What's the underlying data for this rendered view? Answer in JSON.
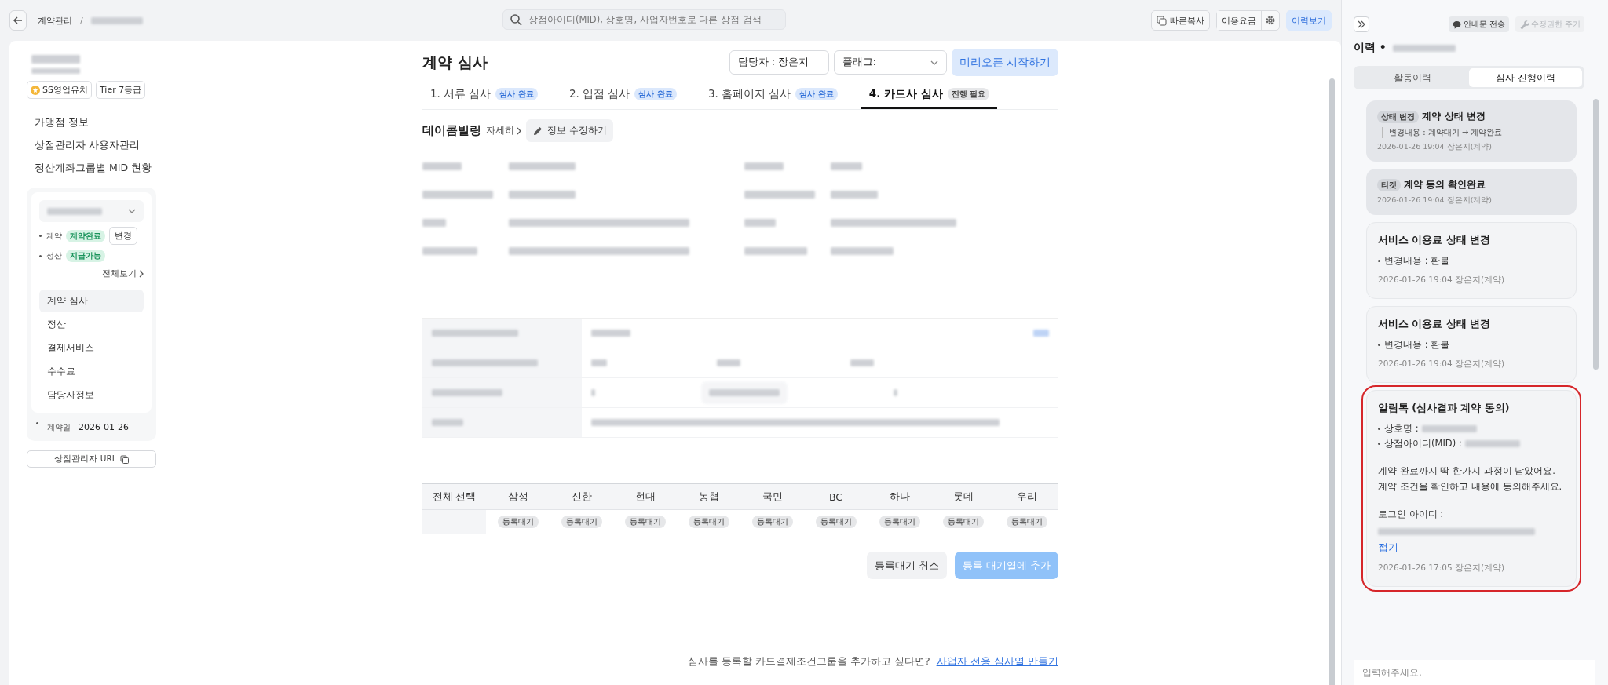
{
  "topbar": {
    "breadcrumb": "계약관리",
    "separator": "/",
    "search_placeholder": "상점아이디(MID), 상호명, 사업자번호로 다른 상점 검색",
    "buttons": [
      {
        "label": "빠른복사",
        "kind": "copy",
        "selected": false
      },
      {
        "label": "이용요금",
        "kind": "fee",
        "selected": false
      },
      {
        "label": "이력보기",
        "kind": "history",
        "selected": true
      }
    ]
  },
  "sidebar": {
    "badges": [
      {
        "label": "SS영업유치",
        "kind": "star"
      },
      {
        "label": "Tier 7등급",
        "kind": "plain"
      }
    ],
    "links": [
      "가맹점 정보",
      "상점관리자 사용자관리",
      "정산계좌그룹별 MID 현황"
    ],
    "contract_card": {
      "status_rows": [
        {
          "label": "계약",
          "badge": "계약완료",
          "action": "변경"
        },
        {
          "label": "정산",
          "badge": "지급가능"
        }
      ],
      "view_all": "전체보기",
      "menu": [
        {
          "label": "계약 심사",
          "selected": true
        },
        {
          "label": "정산",
          "selected": false
        },
        {
          "label": "결제서비스",
          "selected": false
        },
        {
          "label": "수수료",
          "selected": false
        },
        {
          "label": "담당자정보",
          "selected": false
        }
      ],
      "date_label": "계약일",
      "date": "2026-01-26"
    },
    "url_button": "상점관리자 URL"
  },
  "review": {
    "title": "계약 심사",
    "assignee_label": "담당자 :",
    "assignee": "장은지",
    "flag_label": "플래그:",
    "start_button": "미리오픈 시작하기",
    "steps": [
      {
        "label": "1. 서류 심사",
        "badge": "심사 완료",
        "done": true,
        "selected": false
      },
      {
        "label": "2. 입점 심사",
        "badge": "심사 완료",
        "done": true,
        "selected": false
      },
      {
        "label": "3. 홈페이지 심사",
        "badge": "심사 완료",
        "done": true,
        "selected": false
      },
      {
        "label": "4. 카드사 심사",
        "badge": "진행 필요",
        "done": false,
        "selected": true
      }
    ],
    "company": "데이콤빌링",
    "detail_link": "자세히",
    "edit_button": "정보 수정하기",
    "card_table": {
      "select_all": "전체 선택",
      "cards": [
        {
          "name": "삼성",
          "status": "등록대기"
        },
        {
          "name": "신한",
          "status": "등록대기"
        },
        {
          "name": "현대",
          "status": "등록대기"
        },
        {
          "name": "농협",
          "status": "등록대기"
        },
        {
          "name": "국민",
          "status": "등록대기"
        },
        {
          "name": "BC",
          "status": "등록대기"
        },
        {
          "name": "하나",
          "status": "등록대기"
        },
        {
          "name": "롯데",
          "status": "등록대기"
        },
        {
          "name": "우리",
          "status": "등록대기"
        }
      ]
    },
    "cancel_button": "등록대기 취소",
    "add_button": "등록 대기열에 추가",
    "add_disabled": true,
    "footer_text": "심사를 등록할 카드결제조건그룹을 추가하고 싶다면?",
    "footer_link": "사업자 전용 심사열 만들기"
  },
  "history_panel": {
    "notice_button": "안내문 전송",
    "grant_button": "수정권한 주기",
    "grant_disabled": true,
    "title": "이력 •",
    "tabs": [
      {
        "label": "활동이력",
        "selected": false
      },
      {
        "label": "심사 진행이력",
        "selected": true
      }
    ],
    "entries": [
      {
        "kind": "system",
        "tag": "상태 변경",
        "title": "계약 상태 변경",
        "detail": "변경내용 : 계약대기 → 계약완료",
        "meta": "2026-01-26 19:04 장은지(계약)",
        "highlighted": false
      },
      {
        "kind": "system",
        "tag": "티켓",
        "title": "계약 동의 확인완료",
        "meta": "2026-01-26 19:04 장은지(계약)",
        "highlighted": false
      },
      {
        "kind": "note",
        "title": "서비스 이용료 상태 변경",
        "bullets": [
          "변경내용 : 환불"
        ],
        "meta": "2026-01-26 19:04 장은지(계약)",
        "highlighted": false
      },
      {
        "kind": "note",
        "title": "서비스 이용료 상태 변경",
        "bullets": [
          "변경내용 : 환불"
        ],
        "meta": "2026-01-26 19:04 장은지(계약)",
        "highlighted": false
      },
      {
        "kind": "message",
        "title": "알림톡 (심사결과 계약 동의)",
        "bullets": [
          "상호명 :",
          "상점아이디(MID) :"
        ],
        "message": "계약 완료까지 딱 한가지 과정이 남았어요. 계약 조건을 확인하고 내용에 동의해주세요.",
        "login_label": "로그인 아이디 :",
        "collapse_link": "접기",
        "meta": "2026-01-26 17:05 장은지(계약)",
        "highlighted": true
      }
    ],
    "input_placeholder": "입력해주세요."
  }
}
